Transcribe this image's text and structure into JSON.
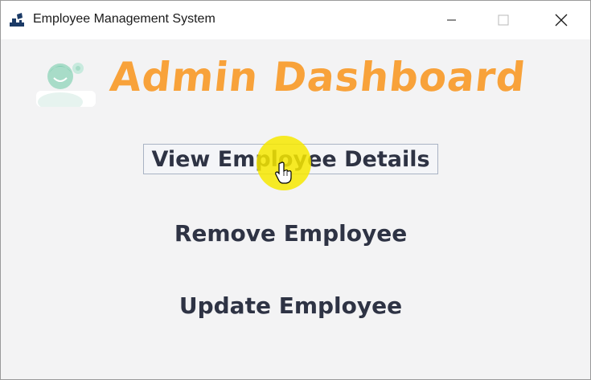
{
  "window": {
    "title": "Employee Management System",
    "icons": {
      "app": "employee-app-icon",
      "minimize": "minimize-icon",
      "maximize": "maximize-icon",
      "close": "close-icon"
    }
  },
  "header": {
    "title": "Admin Dashboard",
    "avatar_icon": "admin-user-icon",
    "title_color": "#f8a23a"
  },
  "menu": {
    "view_details": "View Employee Details",
    "remove": "Remove Employee",
    "update": "Update Employee"
  },
  "colors": {
    "button_text": "#2e3344",
    "cursor_highlight": "#f6e800"
  }
}
